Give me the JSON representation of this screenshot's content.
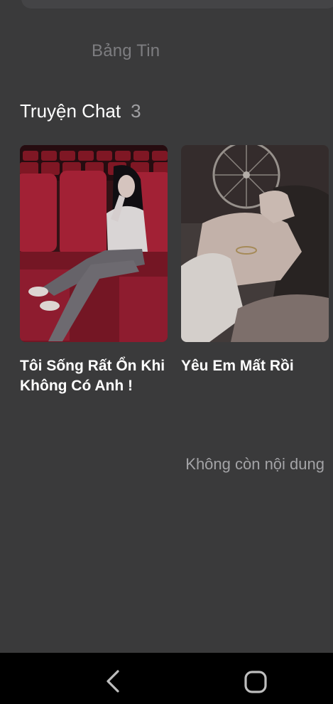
{
  "feed_tab": {
    "label": "Bảng Tin"
  },
  "section": {
    "title": "Truyện Chat",
    "count": "3"
  },
  "stories": [
    {
      "title": "Tôi Sống Rất Ổn Khi Không Có Anh !",
      "image": "girl-in-cinema-seat-photo"
    },
    {
      "title": "Yêu Em Mất Rồi",
      "image": "holding-hands-photo"
    }
  ],
  "end_message": "Không còn nội dung",
  "nav": {
    "back_icon": "back-chevron-icon",
    "home_icon": "home-rounded-square-icon"
  },
  "colors": {
    "background": "#3a3a3b",
    "muted_text": "#7d7d80",
    "nav_bar": "#000000"
  }
}
